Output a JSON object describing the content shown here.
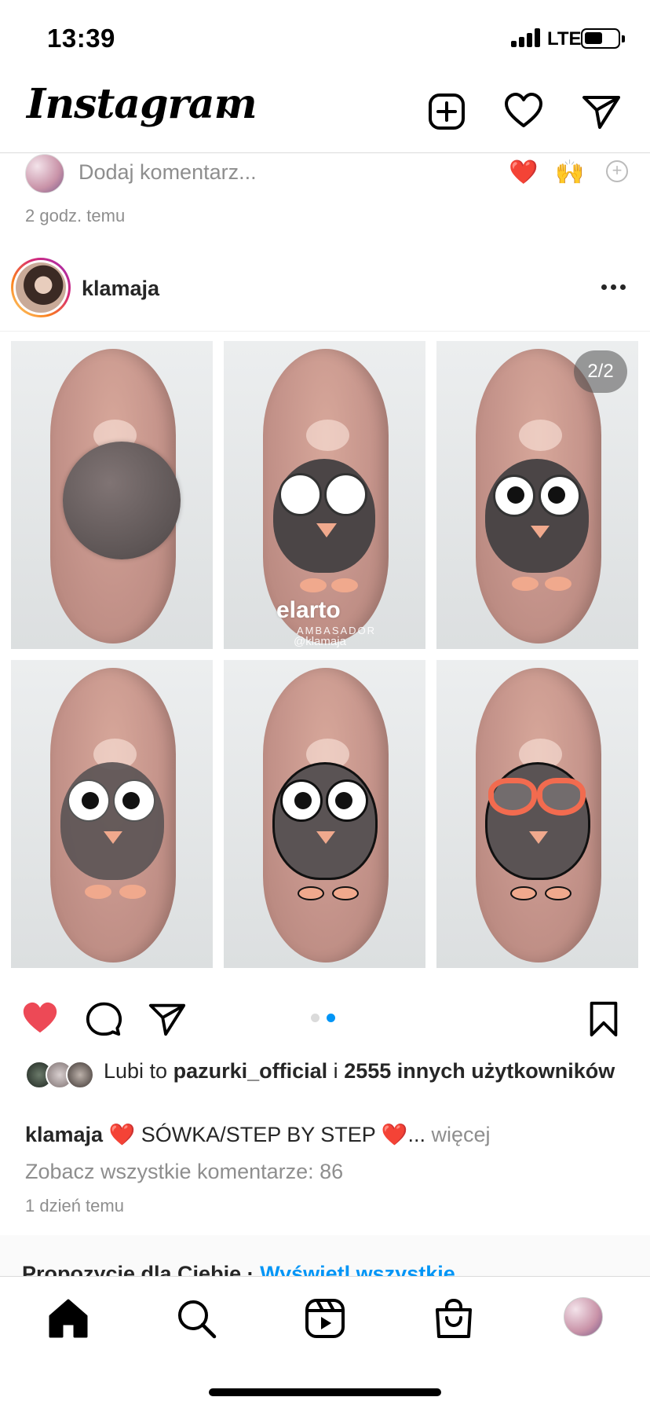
{
  "status_bar": {
    "time": "13:39",
    "network": "LTE",
    "battery_level": 0.45
  },
  "header": {
    "logo": "Instagram",
    "icons": [
      "add-post-icon",
      "heart-icon",
      "direct-message-icon"
    ]
  },
  "previous_post": {
    "comment_placeholder": "Dodaj komentarz...",
    "quick_emojis": [
      "❤️",
      "🙌"
    ],
    "time": "2 godz. temu"
  },
  "post": {
    "username": "klamaja",
    "carousel_counter": "2/2",
    "watermark": {
      "brand": "elarto",
      "sub": "AMBASADOR",
      "handle": "@klamaja"
    },
    "carousel_active_index": 2,
    "carousel_total": 2,
    "likes": {
      "prefix": "Lubi to",
      "first_user": "pazurki_official",
      "joiner": "i",
      "others": "2555 innych użytkowników"
    },
    "caption": {
      "username": "klamaja",
      "text": "❤️ SÓWKA/STEP BY STEP ❤️...",
      "more": "więcej"
    },
    "view_comments": "Zobacz wszystkie komentarze: 86",
    "time": "1 dzień temu",
    "liked": true
  },
  "suggestions": {
    "title": "Propozycje dla Ciebie",
    "separator": "·",
    "link": "Wyświetl wszystkie"
  },
  "tabbar": {
    "tabs": [
      "home-icon",
      "search-icon",
      "reels-icon",
      "shop-icon",
      "profile-avatar"
    ]
  },
  "colors": {
    "like_red": "#ed4956",
    "link_blue": "#0095f6",
    "secondary_text": "#8e8e8e",
    "active_dot": "#0095f6"
  }
}
